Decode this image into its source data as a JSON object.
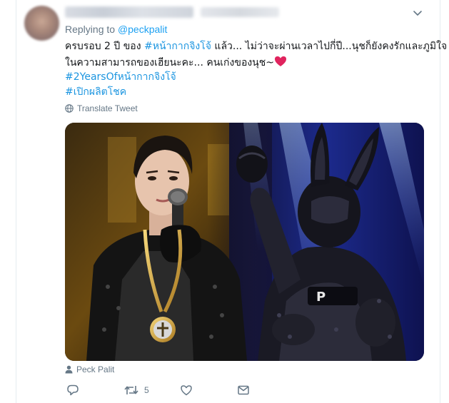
{
  "tweet": {
    "replying_prefix": "Replying to ",
    "replying_handle": "@peckpalit",
    "lines": [
      {
        "parts": [
          {
            "text": "ครบรอบ 2 ปี ของ ",
            "tag": false
          },
          {
            "text": "#หน้ากากจิงโจ้",
            "tag": true
          },
          {
            "text": " แล้ว... ไม่ว่าจะผ่านเวลาไปกี่ปี...นุชก็ยังคงรักและภูมิใจ",
            "tag": false
          }
        ]
      },
      {
        "parts": [
          {
            "text": "ในความสามารถของเฮียนะคะ... คนเก่งของนุช~",
            "tag": false
          }
        ],
        "heart": true
      },
      {
        "parts": [
          {
            "text": "#2YearsOfหน้ากากจิงโจ้",
            "tag": true
          }
        ]
      },
      {
        "parts": [
          {
            "text": "#เปิกผลิตโชค",
            "tag": true
          }
        ]
      }
    ],
    "translate_label": "Translate Tweet",
    "media_credit": "Peck Palit",
    "retweet_count": "5"
  },
  "colors": {
    "link": "#1b95e0",
    "muted": "#657786",
    "heart": "#e0245e"
  },
  "icons": {
    "caret": "chevron-down-icon",
    "globe": "globe-icon",
    "person": "person-icon",
    "reply": "reply-icon",
    "retweet": "retweet-icon",
    "like": "heart-icon",
    "dm": "envelope-icon"
  }
}
